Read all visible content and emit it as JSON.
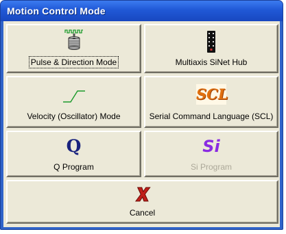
{
  "window": {
    "title": "Motion Control Mode"
  },
  "buttons": {
    "pulse_direction": {
      "label": "Pulse & Direction Mode",
      "icon": "stepper-motor-icon"
    },
    "multiaxis": {
      "label": "Multiaxis SiNet Hub",
      "icon": "hub-chip-icon"
    },
    "velocity": {
      "label": "Velocity (Oscillator) Mode",
      "icon": "ramp-waveform-icon"
    },
    "scl": {
      "label": "Serial Command Language (SCL)",
      "icon": "scl-logo-icon",
      "icon_text": "SCL"
    },
    "q_program": {
      "label": "Q Program",
      "icon": "q-logo-icon",
      "icon_text": "Q"
    },
    "si_program": {
      "label": "Si Program",
      "icon": "si-logo-icon",
      "icon_text": "Si",
      "disabled": true
    },
    "cancel": {
      "label": "Cancel",
      "icon": "red-x-icon"
    }
  },
  "colors": {
    "title_bar": "#2058d6",
    "dialog_face": "#ece9d8",
    "green_signal": "#1a9a2a",
    "scl_orange": "#e07010",
    "si_purple": "#8a2be2",
    "q_navy": "#1a237e",
    "cancel_red": "#c0201a"
  }
}
